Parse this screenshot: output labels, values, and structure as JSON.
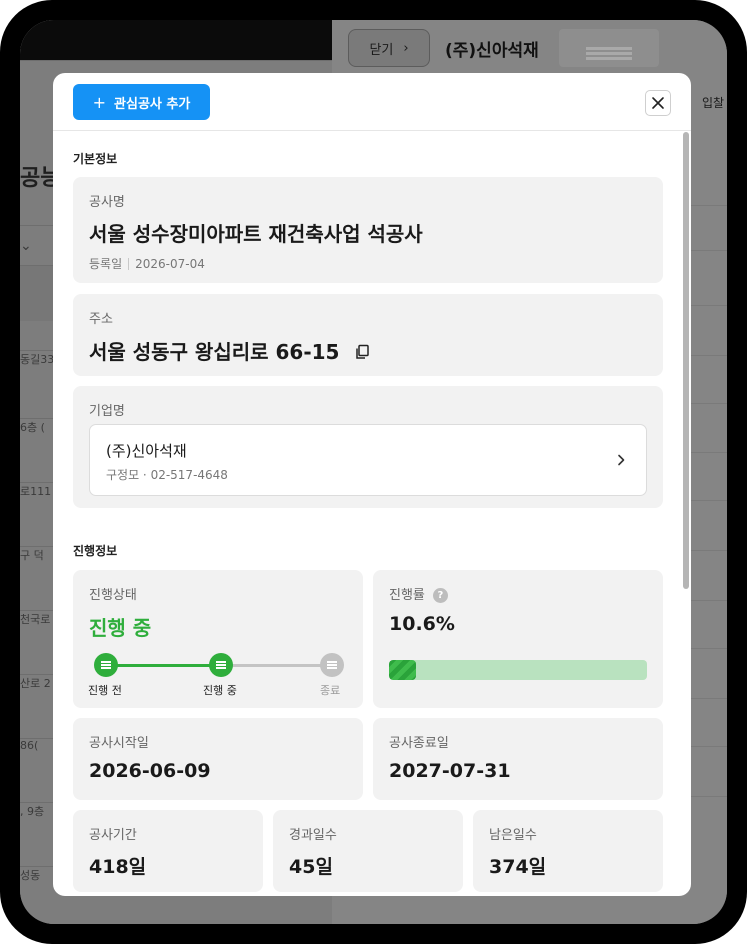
{
  "background": {
    "close_label": "닫기",
    "company_title": "(주)신아석재",
    "bid_label": "입찰",
    "left_heading": "공능",
    "left_rows": [
      "동길33,",
      "6층 (",
      "로111",
      "구 덕",
      "천국로",
      "산로 2",
      "86(",
      ", 9층",
      "성동"
    ]
  },
  "modal": {
    "add_button_label": "관심공사 추가",
    "basic": {
      "section_title": "기본정보",
      "project_name_label": "공사명",
      "project_name": "서울 성수장미아파트 재건축사업 석공사",
      "registered_label": "등록일",
      "registered_date": "2026-07-04",
      "address_label": "주소",
      "address": "서울 성동구 왕십리로 66-15",
      "company_label": "기업명",
      "company_name": "(주)신아석재",
      "company_sub": "구정모 · 02-517-4648"
    },
    "progress": {
      "section_title": "진행정보",
      "status_label": "진행상태",
      "status_value": "진행 중",
      "steps": [
        "진행 전",
        "진행 중",
        "종료"
      ],
      "rate_label": "진행률",
      "rate_value": "10.6%",
      "rate_fraction": 0.106,
      "start_label": "공사시작일",
      "start_date": "2026-06-09",
      "end_label": "공사종료일",
      "end_date": "2027-07-31",
      "duration_label": "공사기간",
      "duration_value": "418일",
      "elapsed_label": "경과일수",
      "elapsed_value": "45일",
      "remaining_label": "남은일수",
      "remaining_value": "374일"
    }
  },
  "colors": {
    "accent": "#1592f5",
    "status_green": "#2fae3c",
    "progress_track": "#b9e2bf"
  }
}
